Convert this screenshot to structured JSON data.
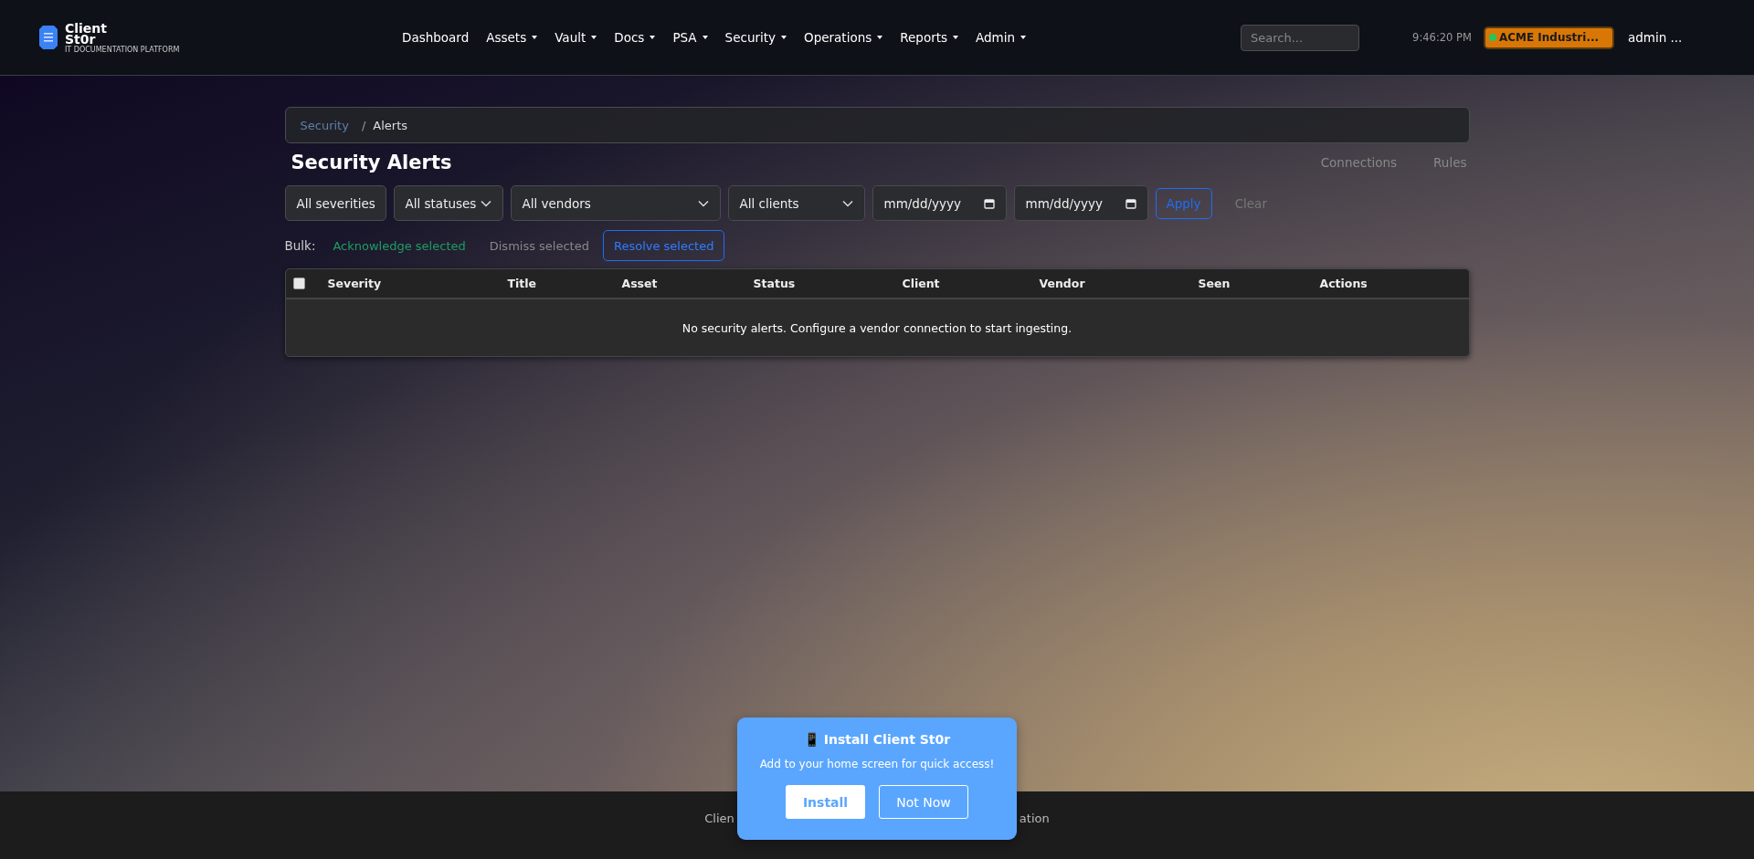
{
  "brand": {
    "name_line1": "Client",
    "name_line2": "St0r",
    "tagline": "IT DOCUMENTATION PLATFORM"
  },
  "nav": [
    {
      "label": "Dashboard",
      "has_menu": false
    },
    {
      "label": "Assets",
      "has_menu": true
    },
    {
      "label": "Vault",
      "has_menu": true
    },
    {
      "label": "Docs",
      "has_menu": true
    },
    {
      "label": "PSA",
      "has_menu": true
    },
    {
      "label": "Security",
      "has_menu": true
    },
    {
      "label": "Operations",
      "has_menu": true
    },
    {
      "label": "Reports",
      "has_menu": true
    },
    {
      "label": "Admin",
      "has_menu": true
    }
  ],
  "search": {
    "placeholder": "Search..."
  },
  "clock": "9:46:20 PM",
  "org_badge": {
    "label": "ACME Industri...",
    "color": "#22c55e"
  },
  "user": "admin ...",
  "breadcrumb": [
    {
      "label": "Security",
      "kind": "link"
    },
    {
      "label": "/",
      "kind": "separator"
    },
    {
      "label": "Alerts",
      "kind": "current"
    }
  ],
  "page_title": "Security Alerts",
  "header_links": [
    "Connections",
    "Rules"
  ],
  "filters": [
    {
      "kind": "select",
      "value": "All severities"
    },
    {
      "kind": "select",
      "value": "All statuses"
    },
    {
      "kind": "select",
      "value": "All vendors"
    },
    {
      "kind": "select",
      "value": "All clients"
    },
    {
      "kind": "date",
      "value": "mm/dd/yyyy"
    },
    {
      "kind": "date",
      "value": "mm/dd/yyyy"
    }
  ],
  "filter_actions": [
    {
      "label": "Apply",
      "kind": "primary"
    },
    {
      "label": "Clear",
      "kind": "muted"
    }
  ],
  "bulk": {
    "label": "Bulk:",
    "actions": [
      {
        "label": "Acknowledge selected",
        "kind": "success"
      },
      {
        "label": "Dismiss selected",
        "kind": "muted"
      },
      {
        "label": "Resolve selected",
        "kind": "outline"
      }
    ]
  },
  "table": {
    "select_all": {
      "checked": false
    },
    "columns": [
      "Severity",
      "Title",
      "Asset",
      "Status",
      "Client",
      "Vendor",
      "Seen",
      "Actions"
    ],
    "empty_message": "No security alerts. Configure a vendor connection to start ingesting."
  },
  "footer": {
    "visible_left": "Clien",
    "visible_right": "ation"
  },
  "install_prompt": {
    "icon": "📱",
    "title": "Install Client St0r",
    "message": "Add to your home screen for quick access!",
    "buttons": [
      {
        "label": "Install",
        "kind": "solid"
      },
      {
        "label": "Not Now",
        "kind": "outline"
      }
    ]
  }
}
